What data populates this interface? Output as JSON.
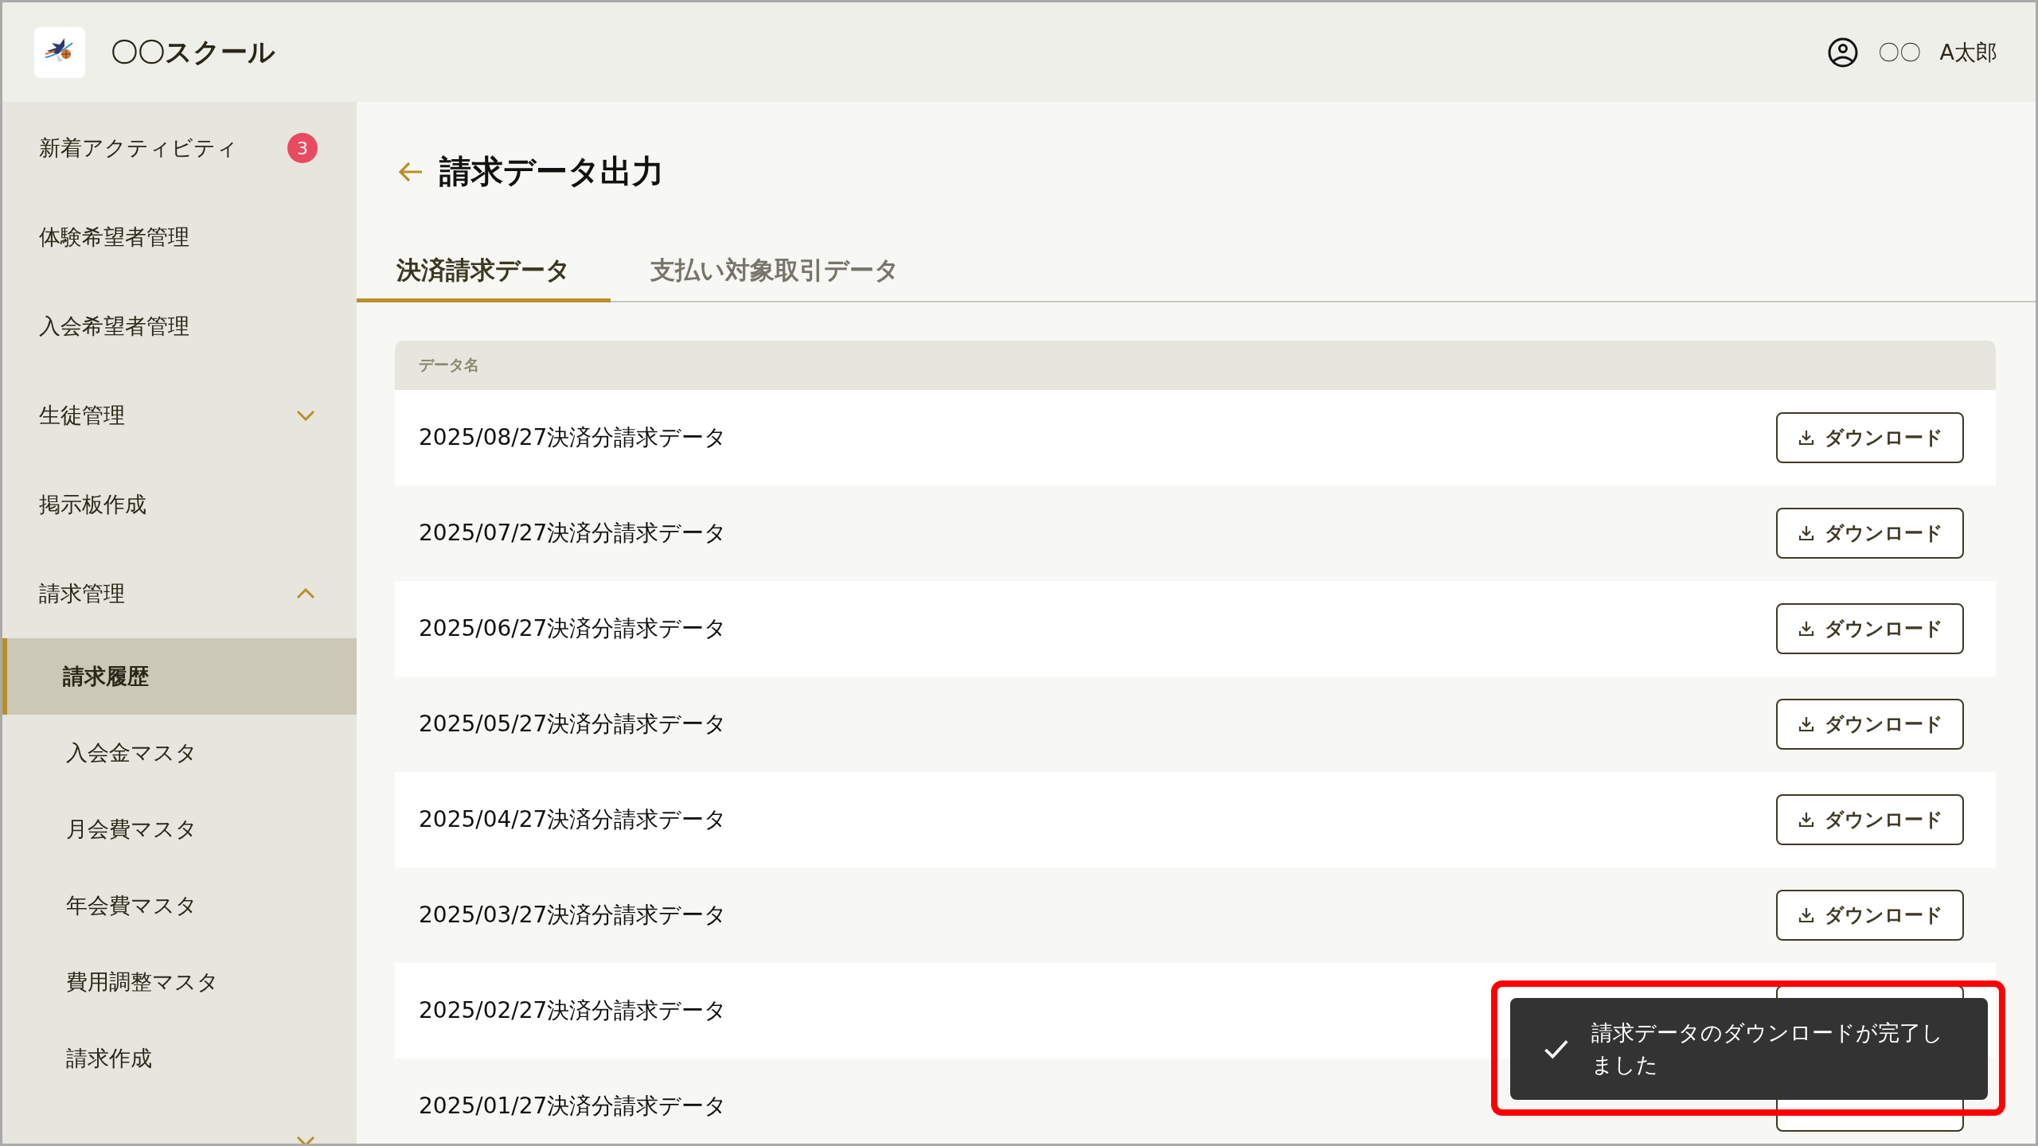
{
  "header": {
    "school_name": "〇〇スクール",
    "user_name": [
      "〇〇",
      "A太郎"
    ]
  },
  "sidebar": {
    "items": [
      {
        "label": "新着アクティビティ",
        "badge": "3",
        "selected": false
      },
      {
        "label": "体験希望者管理",
        "selected": false
      },
      {
        "label": "入会希望者管理",
        "selected": false
      },
      {
        "label": "生徒管理",
        "selected": false,
        "expanded": false
      },
      {
        "label": "掲示板作成",
        "selected": false
      },
      {
        "label": "請求管理",
        "selected": false,
        "expanded": true,
        "children": [
          {
            "label": "請求履歴",
            "selected": true
          },
          {
            "label": "入会金マスタ",
            "selected": false
          },
          {
            "label": "月会費マスタ",
            "selected": false
          },
          {
            "label": "年会費マスタ",
            "selected": false
          },
          {
            "label": "費用調整マスタ",
            "selected": false
          },
          {
            "label": "請求作成",
            "selected": false
          }
        ]
      },
      {
        "selected": false,
        "expanded": false
      }
    ]
  },
  "page_title": "請求データ出力",
  "tabs": [
    {
      "label": "決済請求データ",
      "selected": true
    },
    {
      "label": "支払い対象取引データ",
      "selected": false
    }
  ],
  "table": {
    "columns": [
      "データ名"
    ],
    "rows": [
      {
        "name": "2025/08/27決済分請求データ",
        "action": "ダウンロード"
      },
      {
        "name": "2025/07/27決済分請求データ",
        "action": "ダウンロード"
      },
      {
        "name": "2025/06/27決済分請求データ",
        "action": "ダウンロード"
      },
      {
        "name": "2025/05/27決済分請求データ",
        "action": "ダウンロード"
      },
      {
        "name": "2025/04/27決済分請求データ",
        "action": "ダウンロード"
      },
      {
        "name": "2025/03/27決済分請求データ",
        "action": "ダウンロード"
      },
      {
        "name": "2025/02/27決済分請求データ"
      },
      {
        "name": "2025/01/27決済分請求データ"
      }
    ]
  },
  "toast": {
    "message": "請求データのダウンロードが完了しました",
    "highlighted": true
  }
}
